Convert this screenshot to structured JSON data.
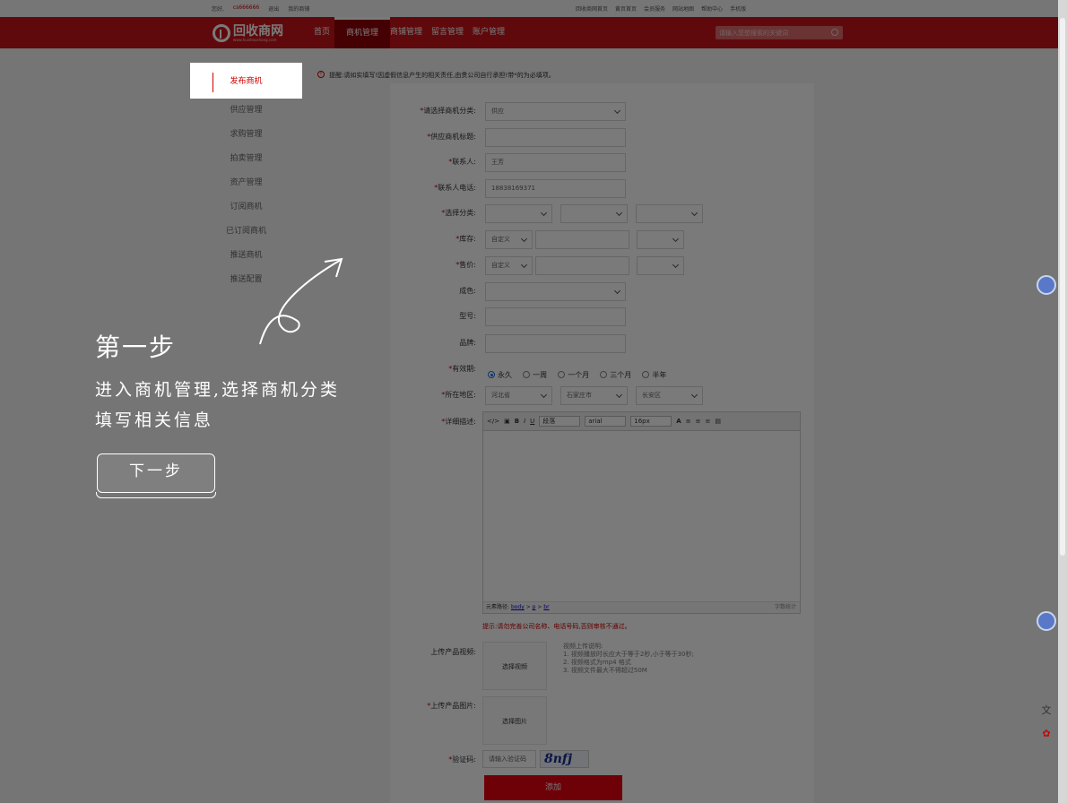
{
  "topbar": {
    "greeting": "您好,",
    "user": "cs666666",
    "logout": "退出",
    "my_msgs": "我的商铺",
    "links": [
      "回收商网首页",
      "黄页首页",
      "会员服务",
      "网站地图",
      "帮助中心",
      "手机版"
    ]
  },
  "header": {
    "logo_text": "回收商网",
    "logo_sub": "www.huishoushang.com",
    "nav": [
      "首页",
      "商机管理",
      "商铺管理",
      "留言管理",
      "账户管理"
    ],
    "search_placeholder": "请输入您想搜索的关键词"
  },
  "sidebar": {
    "items": [
      "发布商机",
      "供应管理",
      "求购管理",
      "拍卖管理",
      "资产管理",
      "订阅商机",
      "已订阅商机",
      "推送商机",
      "推送配置"
    ]
  },
  "tip": "提醒:请如实填写!因虚假信息产生的相关责任,由贵公司自行承担!带*的为必填项。",
  "form": {
    "category_label": "请选择商机分类:",
    "category_value": "供应",
    "title_label": "供应商机标题:",
    "contact_label": "联系人:",
    "contact_value": "王芳",
    "phone_label": "联系人电话:",
    "phone_value": "18838169371",
    "type_label": "选择分类:",
    "stock_label": "库存:",
    "stock_unit": "自定义",
    "price_label": "售价:",
    "price_unit": "自定义",
    "quality_label": "成色:",
    "model_label": "型号:",
    "brand_label": "品牌:",
    "valid_label": "有效期:",
    "valid_options": [
      "永久",
      "一周",
      "一个月",
      "三个月",
      "半年"
    ],
    "region_label": "所在地区:",
    "region_values": [
      "河北省",
      "石家庄市",
      "长安区"
    ],
    "detail_label": "详细描述:",
    "editor": {
      "para": "段落",
      "font": "arial",
      "size": "16px",
      "path_label": "元素路径:",
      "path_body": "body",
      "path_p": "p",
      "path_br": "br",
      "count": "字数统计"
    },
    "hint": "提示:请勿完善公司名称、电话号码,否则审核不通过。",
    "video_label": "上传产品视频:",
    "video_btn": "选择视频",
    "video_notes": [
      "视频上传说明:",
      "1. 视频播放时长应大于等于2秒,小于等于30秒;",
      "2. 视频格式为mp4 格式",
      "3. 视频文件最大不得超过50M"
    ],
    "image_label": "上传产品图片:",
    "image_btn": "选择图片",
    "captcha_label": "验证码:",
    "captcha_placeholder": "请输入验证码",
    "captcha_text": "8nfj",
    "submit": "添加"
  },
  "guide": {
    "heading": "第一步",
    "line1": "进入商机管理,选择商机分类",
    "line2": "填写相关信息",
    "next": "下一步"
  }
}
